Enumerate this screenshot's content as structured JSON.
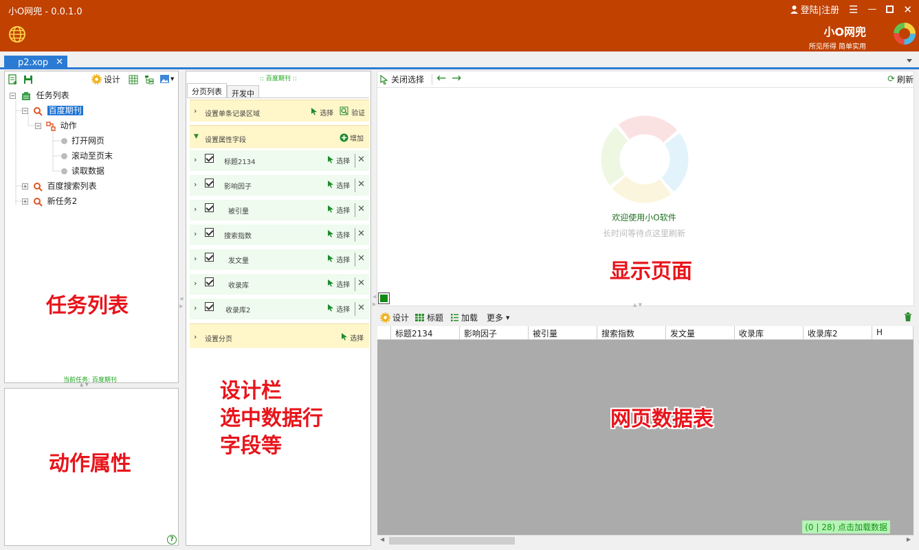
{
  "window": {
    "title": "小O网兜 - 0.0.1.0",
    "login": "登陆|注册",
    "brand_name": "小O网兜",
    "brand_slogan": "所见所得 简单实用"
  },
  "tabs": [
    {
      "label": "p2.xop"
    }
  ],
  "left_toolbar": {
    "design": "设计"
  },
  "tree": {
    "root": "任务列表",
    "task1": "百度期刊",
    "action": "动作",
    "step1": "打开网页",
    "step2": "滚动至页末",
    "step3": "读取数据",
    "task2": "百度搜索列表",
    "task3": "新任务2"
  },
  "left_footer": {
    "current_task": "当前任务: 百度期刊"
  },
  "middle": {
    "header": ":: 百度期刊 ::",
    "tab_paging": "分页列表",
    "tab_dev": "开发中",
    "record_area": "设置单条记录区域",
    "select": "选择",
    "verify": "验证",
    "fields_header": "设置属性字段",
    "add": "增加",
    "fields": [
      "标题2134",
      "影响因子",
      "被引量",
      "搜索指数",
      "发文量",
      "收录库",
      "收录库2"
    ],
    "paging": "设置分页"
  },
  "right_toolbar": {
    "close_select": "关闭选择",
    "refresh": "刷新"
  },
  "preview": {
    "welcome": "欢迎使用小O软件",
    "hint": "长时间等待点这里刷新"
  },
  "grid_toolbar": {
    "design": "设计",
    "title": "标题",
    "load": "加载",
    "more": "更多"
  },
  "grid": {
    "columns": [
      "标题2134",
      "影响因子",
      "被引量",
      "搜索指数",
      "发文量",
      "收录库",
      "收录库2",
      "H"
    ],
    "status": "(0 | 28) 点击加载数据"
  },
  "annotations": {
    "task_list": "任务列表",
    "action_props": "动作属性",
    "design_bar_1": "设计栏",
    "design_bar_2": "选中数据行",
    "design_bar_3": "字段等",
    "display_page": "显示页面",
    "data_table": "网页数据表"
  },
  "colors": {
    "titlebar": "#c04100",
    "tab_active": "#2b7bd4",
    "green": "#19a319",
    "annotation": "#e8141b"
  }
}
